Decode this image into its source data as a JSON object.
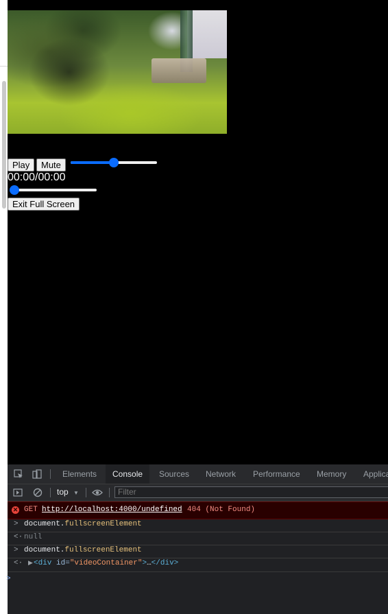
{
  "video": {
    "play_label": "Play",
    "mute_label": "Mute",
    "volume_level": 0.5,
    "time_display": "00:00/00:00",
    "progress_level": 0.0,
    "exit_fullscreen_label": "Exit Full Screen"
  },
  "devtools": {
    "tabs": [
      "Elements",
      "Console",
      "Sources",
      "Network",
      "Performance",
      "Memory",
      "Applica"
    ],
    "active_tab": "Console",
    "context_label": "top",
    "filter_placeholder": "Filter",
    "error": {
      "method": "GET",
      "url": "http://localhost:4000/undefined",
      "status": "404 (Not Found)"
    },
    "entries": [
      {
        "command_obj": "document.",
        "command_prop": "fullscreenElement",
        "result": "null"
      },
      {
        "command_obj": "document.",
        "command_prop": "fullscreenElement",
        "result_tag_open": "<div ",
        "result_attr": "id=",
        "result_val": "\"videoContainer\"",
        "result_mid": ">",
        "result_ellipsis": "…",
        "result_tag_close": "</div>"
      }
    ]
  },
  "colors": {
    "accent": "#0a6cff",
    "devtools_bg": "#202124",
    "error_bg": "#290000",
    "error_text": "#f28b82"
  }
}
